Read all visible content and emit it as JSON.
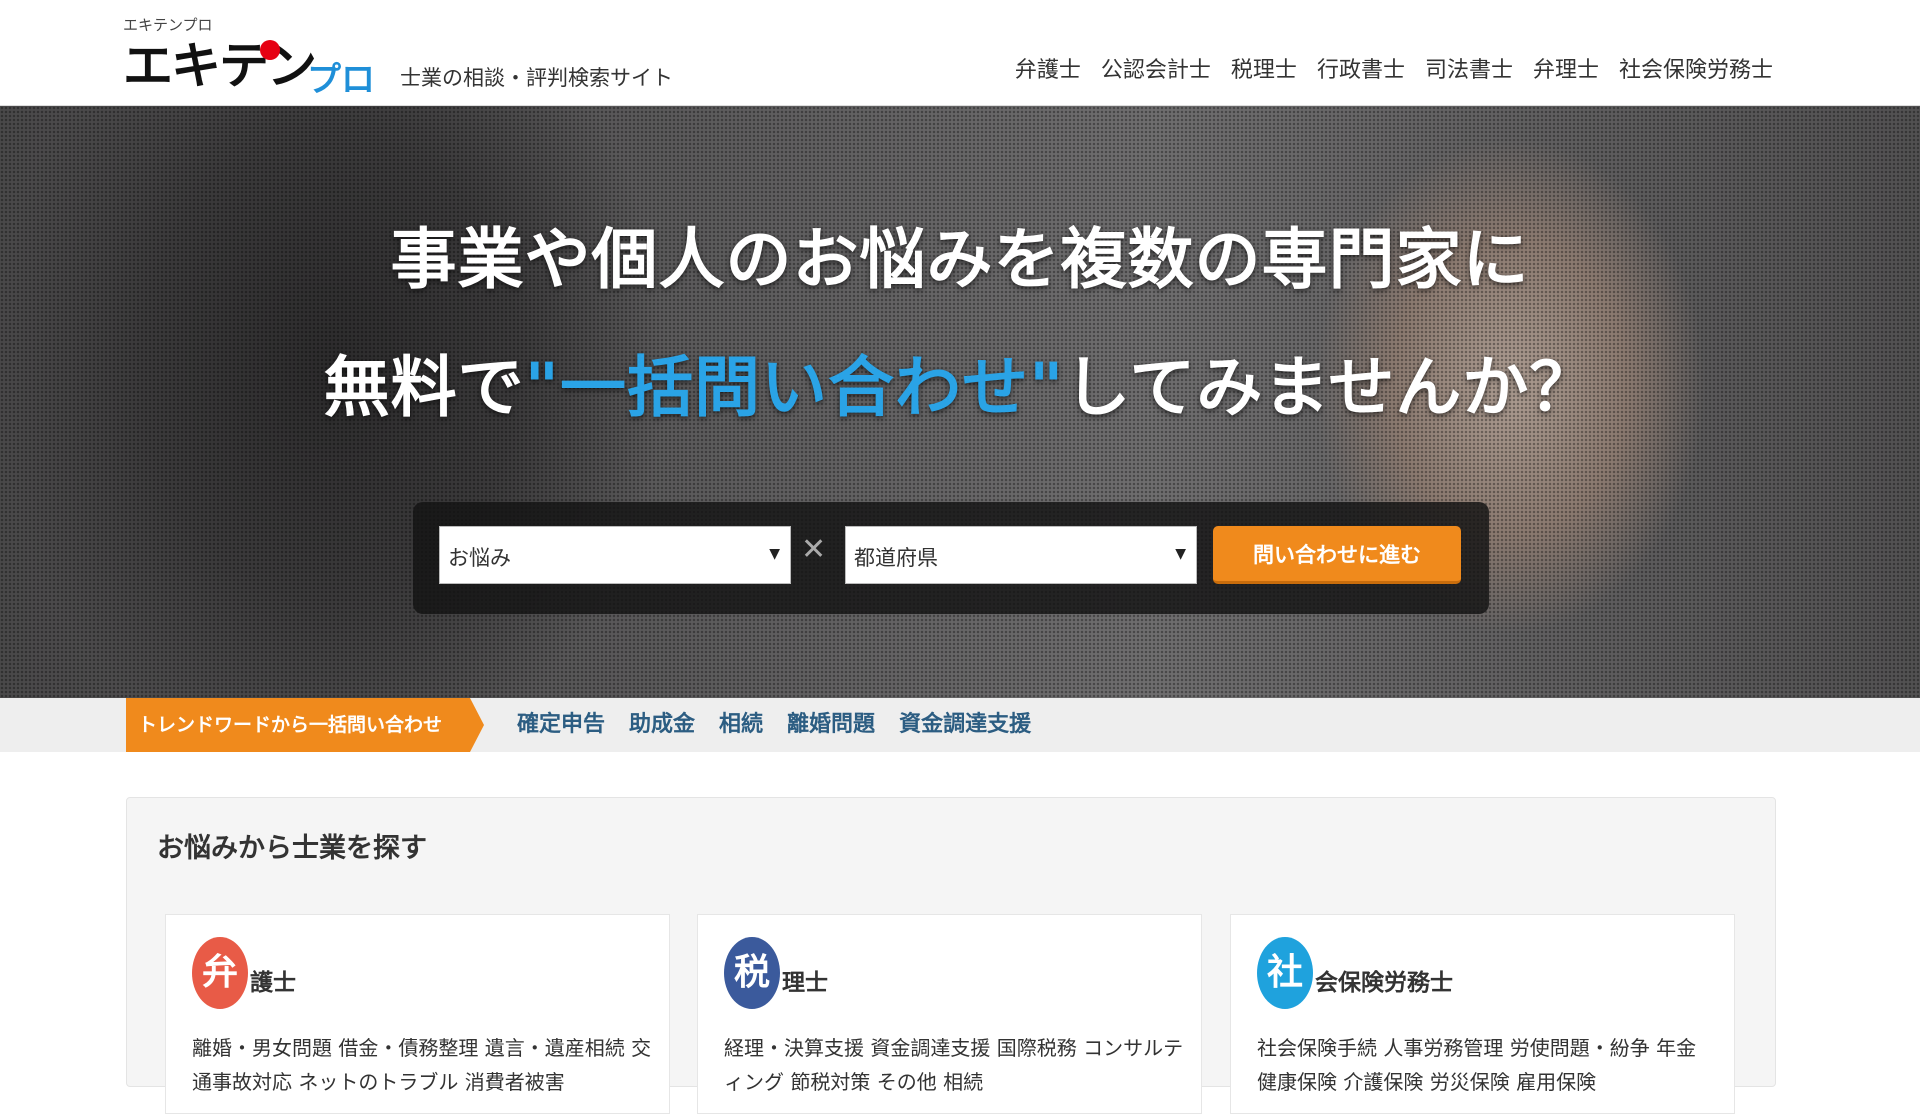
{
  "header": {
    "logo_small": "エキテンプロ",
    "logo_main": "エキテン",
    "logo_pro": "プロ",
    "tagline": "士業の相談・評判検索サイト",
    "nav": [
      "弁護士",
      "公認会計士",
      "税理士",
      "行政書士",
      "司法書士",
      "弁理士",
      "社会保険労務士"
    ]
  },
  "hero": {
    "line1": "事業や個人のお悩みを複数の専門家に",
    "line2_pre": "無料で",
    "line2_highlight": "\"一括問い合わせ\"",
    "line2_post": "してみませんか？",
    "search": {
      "worry_value": "お悩み",
      "pref_value": "都道府県",
      "times_symbol": "✕",
      "submit_label": "問い合わせに進む"
    }
  },
  "trend": {
    "tag": "トレンドワードから一括問い合わせ",
    "links": [
      "確定申告",
      "助成金",
      "相続",
      "離婚問題",
      "資金調達支援"
    ]
  },
  "main": {
    "title": "お悩みから士業を探す",
    "cards": [
      {
        "badge": "弁",
        "title": "護士",
        "links": "離婚・男女問題 借金・債務整理 遺言・遺産相続 交通事故対応 ネットのトラブル 消費者被害"
      },
      {
        "badge": "税",
        "title": "理士",
        "links": "経理・決算支援 資金調達支援 国際税務 コンサルティング 節税対策 その他 相続"
      },
      {
        "badge": "社",
        "title": "会保険労務士",
        "links": "社会保険手続 人事労務管理 労使問題・紛争 年金 健康保険 介護保険 労災保険 雇用保険"
      }
    ]
  },
  "colors": {
    "accent_orange": "#f08a1c",
    "highlight_blue": "#2aa3e6",
    "link_blue": "#2c5d82",
    "logo_red": "#e60012",
    "logo_blue": "#1f8fd8"
  }
}
